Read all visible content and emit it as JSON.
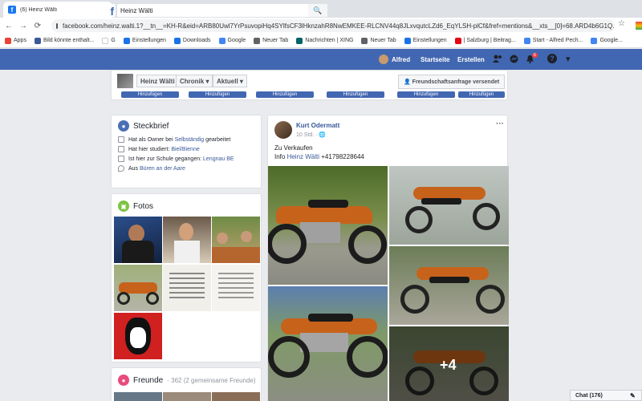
{
  "browser": {
    "tab_title": "(6) Heinz Wälti",
    "tab_close": "×",
    "new_tab": "+",
    "url": "facebook.com/heinz.walti.1?__tn__=KH-R&eid=ARB80Uwl7YrPsuvopiHq4SYlfsCF3lHknzahR8NwEMKEE-RLCNV44q8JLxvqutcLZd6_EqYLSH-plCf&fref=mentions&__xts__[0]=68.ARD4b6G1Q...",
    "back": "←",
    "forward": "→",
    "reload": "⟳",
    "star": "☆"
  },
  "bookmarks": [
    {
      "label": "Apps",
      "color": "#ea4335"
    },
    {
      "label": "Bild könnte enthalt...",
      "color": "#3b5998"
    },
    {
      "label": "G",
      "color": "#ffffff"
    },
    {
      "label": "Einstellungen",
      "color": "#1a73e8"
    },
    {
      "label": "Downloads",
      "color": "#1a73e8"
    },
    {
      "label": "Google",
      "color": "#4285f4"
    },
    {
      "label": "Neuer Tab",
      "color": "#5f6368"
    },
    {
      "label": "Nachrichten | XING",
      "color": "#026466"
    },
    {
      "label": "Neuer Tab",
      "color": "#5f6368"
    },
    {
      "label": "Einstellungen",
      "color": "#1a73e8"
    },
    {
      "label": "| Salzburg | Beitrag...",
      "color": "#e30613"
    },
    {
      "label": "Start - Alfred Pech...",
      "color": "#4285f4"
    },
    {
      "label": "Google...",
      "color": "#4285f4"
    }
  ],
  "fb": {
    "logo": "f",
    "search_value": "Heinz Wälti",
    "search_icon": "🔍",
    "user_name": "Alfred",
    "nav_home": "Startseite",
    "nav_create": "Erstellen",
    "notif_count": "6",
    "help": "?",
    "menu": "▾"
  },
  "profile_bar": {
    "name": "Heinz Wälti",
    "timeline": "Chronik",
    "current": "Aktuell",
    "friend_request": "Freundschaftsanfrage versendet",
    "add_label": "Hinzufügen"
  },
  "steckbrief": {
    "title": "Steckbrief",
    "rows": [
      {
        "prefix": "Hat als Owner bei ",
        "link": "Selbständig",
        "suffix": " gearbeitet"
      },
      {
        "prefix": "Hat hier studiert: ",
        "link": "Biel/Bienne",
        "suffix": ""
      },
      {
        "prefix": "Ist hier zur Schule gegangen: ",
        "link": "Lengnau BE",
        "suffix": ""
      },
      {
        "prefix": "Aus ",
        "link": "Büren an der Aare",
        "suffix": ""
      }
    ]
  },
  "fotos": {
    "title": "Fotos"
  },
  "freunde": {
    "title": "Freunde",
    "count": "· 362 (2 gemeinsame Freunde)"
  },
  "post": {
    "author": "Kurt Odermatt",
    "time": "10 Std. · 🌐",
    "more": "···",
    "line1": "Zu Verkaufen",
    "line2_prefix": "Info ",
    "line2_link": "Heinz Wälti",
    "line2_suffix": " +41798228644",
    "more_photos": "+4"
  },
  "chat": {
    "label": "Chat (176)"
  }
}
